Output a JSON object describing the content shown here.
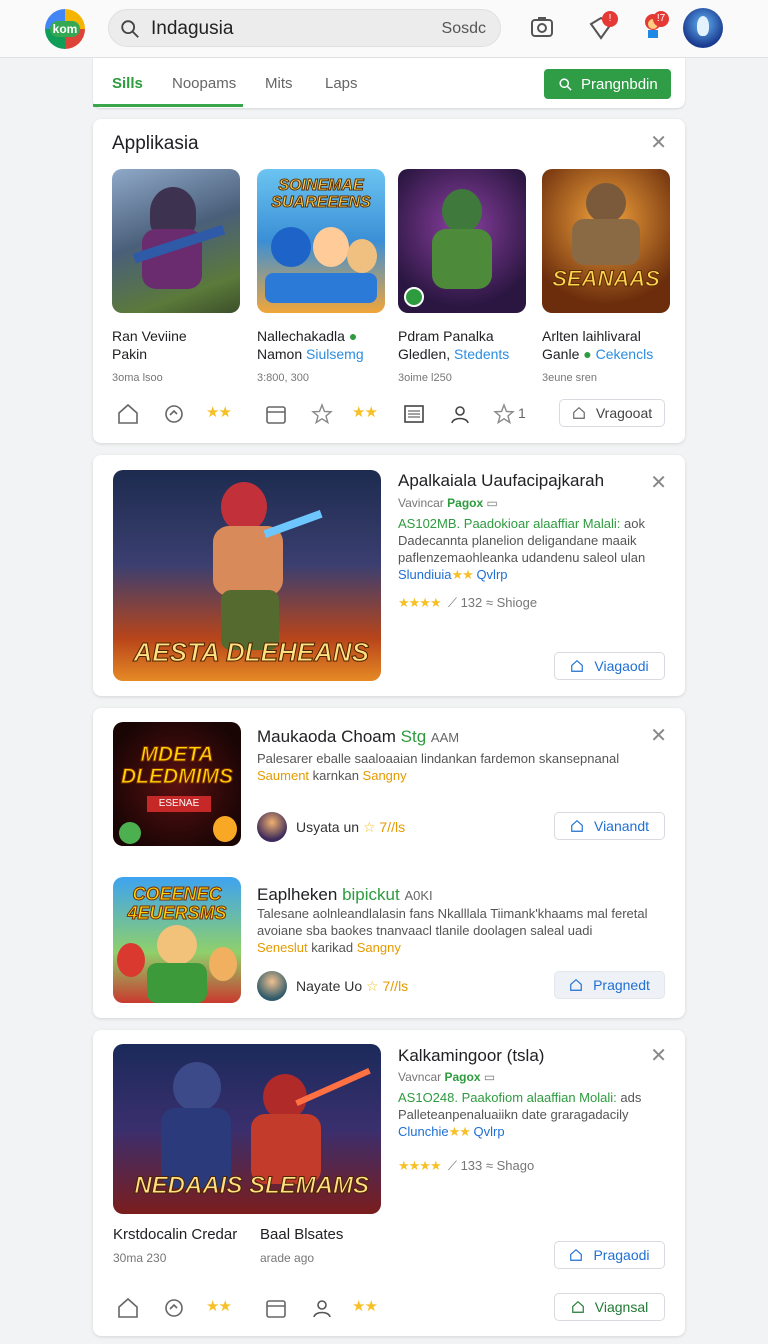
{
  "topbar": {
    "logo_text": "kom",
    "search_value": "Indagusia",
    "search_button": "Sosdc",
    "notif_count_1": "!",
    "notif_count_2": "!7"
  },
  "tabs": {
    "items": [
      "Sills",
      "Noopams",
      "Mits",
      "Laps"
    ],
    "primary_button": "Prangnbdin",
    "accent": "#2f9d46"
  },
  "card1": {
    "title": "Applikasia",
    "apps": [
      {
        "thumb_text": "",
        "line1": "Ran Veviine",
        "line2": "Pakin",
        "line2_highlight": "",
        "meta": "3oma lsoo"
      },
      {
        "thumb_text": "SOINEMAE SUAREEENS",
        "line1": "Nallechakadla",
        "line2": "Namon",
        "line2_highlight": "Siulsemg",
        "meta": "3:800, 300"
      },
      {
        "thumb_text": "",
        "line1": "Pdram Panalka",
        "line2": "Gledlen,",
        "line2_highlight": "Stedents",
        "meta": "3oime l250"
      },
      {
        "thumb_text": "SEANAAS",
        "line1": "Arlten laihlivaral",
        "line2": "Ganle",
        "line2_highlight": "Cekencls",
        "meta": "3eune sren"
      }
    ],
    "action_count": "1",
    "button": "Vragooat"
  },
  "card2": {
    "image_text": "AESTA DLEHEANS",
    "title": "Apalkaiala Uaufacipajkarah",
    "sub_prefix": "Vavincar",
    "sub_accent": "Pagox",
    "desc_green": "AS102MB.",
    "desc_blue": "Paadokioar alaaffiar Malali:",
    "desc_tail": "aok",
    "desc_rest": "Dadecannta planelion deligandane maaik paflenzemaohleanka udandenu saleol ulan",
    "desc_blue2": "Slundiuia",
    "desc_blue3": "Qvlrp",
    "rating_text": "132 ≈ Shioge",
    "button": "Viagaodi"
  },
  "card3": {
    "items": [
      {
        "thumb_text": "MDETA DLEDMIMS",
        "thumb_sub": "ESENAE",
        "title": "Maukaoda Choam",
        "title_accent": "Stg",
        "title_tail": "AAM",
        "desc": "Palesarer eballe saaloaaian lindankan fardemon skansepnanal",
        "desc_orange": "Saument",
        "desc_tail": "karnkan",
        "desc_orange2": "Sangny",
        "user": "Usyata un",
        "user_like": "7//ls",
        "button": "Vianandt"
      },
      {
        "thumb_text": "COEENEC 4EUERSMS",
        "thumb_sub": "",
        "title": "Eaplheken",
        "title_accent": "bipickut",
        "title_tail": "A0KI",
        "desc": "Talesane aolnleandlalasin fans Nkalllala Tiimank'khaams mal feretal avoiane sba baokes tnanvaacl tlanile doolagen saleal uadi",
        "desc_orange": "Seneslut",
        "desc_tail": "karikad",
        "desc_orange2": "Sangny",
        "user": "Nayate Uo",
        "user_like": "7//ls",
        "button": "Pragnedt"
      }
    ]
  },
  "card4": {
    "image_text": "NEDAAIS SLEMAMS",
    "title": "Kalkamingoor (tsla)",
    "sub_prefix": "Vavncar",
    "sub_accent": "Pagox",
    "desc_green": "AS1O248.",
    "desc_blue": "Paakofiom alaaffian Molali:",
    "desc_tail": "ads",
    "desc_rest": "Palleteanpenaluaiikn date graragadacily",
    "desc_blue2": "Clunchie",
    "desc_blue3": "Qvlrp",
    "rating_text": "133 ≈ Shago",
    "button": "Pragaodi",
    "bottom_left_1": "Krstdocalin Credar",
    "bottom_left_2": "30ma 230",
    "bottom_mid_1": "Baal Blsates",
    "bottom_mid_2": "arade ago",
    "bottom_button": "Viagnsal"
  }
}
